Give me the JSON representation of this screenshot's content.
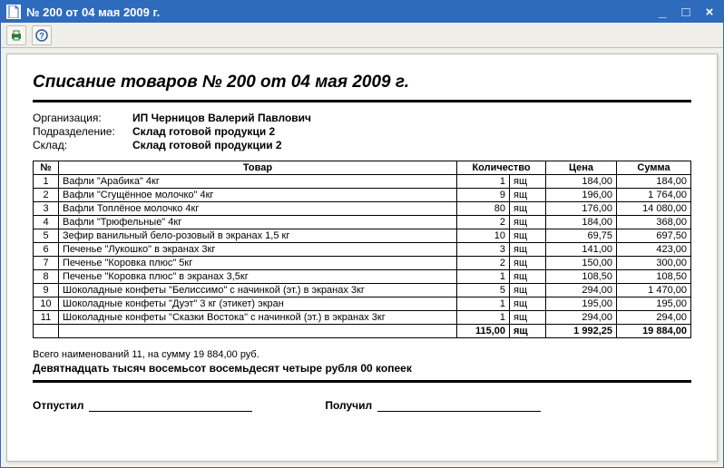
{
  "window": {
    "title": "№ 200 от 04 мая 2009 г."
  },
  "document": {
    "title": "Списание товаров № 200 от 04 мая 2009 г.",
    "meta": {
      "org_label": "Организация:",
      "org_value": "ИП Черницов Валерий Павлович",
      "dept_label": "Подразделение:",
      "dept_value": "Склад готовой продукци 2",
      "store_label": "Склад:",
      "store_value": "Склад готовой продукции 2"
    },
    "headers": {
      "num": "№",
      "tovar": "Товар",
      "qty": "Количество",
      "price": "Цена",
      "sum": "Сумма"
    },
    "rows": [
      {
        "n": "1",
        "name": "Вафли \"Арабика\" 4кг",
        "qty": "1",
        "unit": "ящ",
        "price": "184,00",
        "sum": "184,00"
      },
      {
        "n": "2",
        "name": "Вафли \"Сгущённое молочко\" 4кг",
        "qty": "9",
        "unit": "ящ",
        "price": "196,00",
        "sum": "1 764,00"
      },
      {
        "n": "3",
        "name": "Вафли   Топлёное молочко  4кг",
        "qty": "80",
        "unit": "ящ",
        "price": "176,00",
        "sum": "14 080,00"
      },
      {
        "n": "4",
        "name": "Вафли \"Трюфельные\" 4кг",
        "qty": "2",
        "unit": "ящ",
        "price": "184,00",
        "sum": "368,00"
      },
      {
        "n": "5",
        "name": "Зефир ванильный бело-розовый в экранах 1,5 кг",
        "qty": "10",
        "unit": "ящ",
        "price": "69,75",
        "sum": "697,50"
      },
      {
        "n": "6",
        "name": "Печенье \"Лукошко\" в экранах 3кг",
        "qty": "3",
        "unit": "ящ",
        "price": "141,00",
        "sum": "423,00"
      },
      {
        "n": "7",
        "name": "Печенье \"Коровка плюс\" 5кг",
        "qty": "2",
        "unit": "ящ",
        "price": "150,00",
        "sum": "300,00"
      },
      {
        "n": "8",
        "name": "Печенье \"Коровка плюс\" в экранах 3,5кг",
        "qty": "1",
        "unit": "ящ",
        "price": "108,50",
        "sum": "108,50"
      },
      {
        "n": "9",
        "name": "Шоколадные конфеты \"Белиссимо\" с начинкой (эт.)  в экранах 3кг",
        "qty": "5",
        "unit": "ящ",
        "price": "294,00",
        "sum": "1 470,00"
      },
      {
        "n": "10",
        "name": "Шоколадные конфеты \"Дуэт\"  3 кг (этикет) экран",
        "qty": "1",
        "unit": "ящ",
        "price": "195,00",
        "sum": "195,00"
      },
      {
        "n": "11",
        "name": "Шоколадные конфеты \"Сказки Востока\" с начинкой (эт.)  в экранах 3кг",
        "qty": "1",
        "unit": "ящ",
        "price": "294,00",
        "sum": "294,00"
      }
    ],
    "totals": {
      "qty": "115,00",
      "unit": "ящ",
      "price": "1 992,25",
      "sum": "19 884,00"
    },
    "summary_line": "Всего наименований 11, на сумму 19 884,00 руб.",
    "amount_words": "Девятнадцать тысяч восемьсот восемьдесят четыре рубля 00 копеек",
    "signatures": {
      "released": "Отпустил",
      "received": "Получил"
    }
  }
}
